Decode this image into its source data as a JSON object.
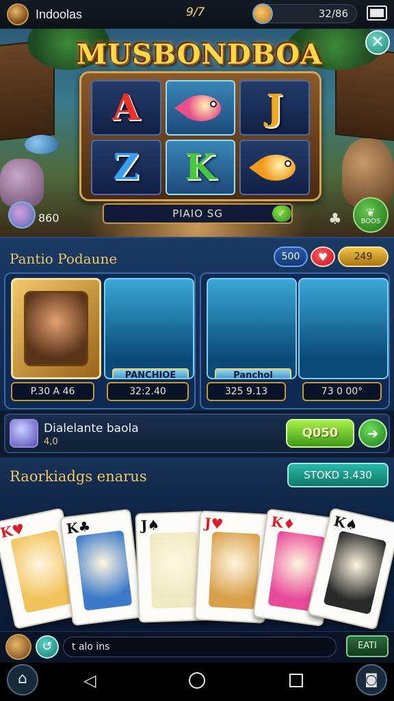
{
  "status_bar": {
    "app_name": "Indoolas",
    "clock": "9/7",
    "coin_balance": "32/86",
    "avatar_icon": "medallion-avatar-icon",
    "coin_icon": "piggy-coin-icon",
    "battery_icon": "battery-icon"
  },
  "hero": {
    "game_title": "MUSBONDBOA",
    "close_icon": "close-icon",
    "reels": [
      {
        "symbol": "A",
        "color": "#e8322a"
      },
      {
        "symbol": "fish",
        "color": "#e8508a"
      },
      {
        "symbol": "J",
        "color": "#f2a81e"
      },
      {
        "symbol": "Z",
        "color": "#3a9ef0"
      },
      {
        "symbol": "K",
        "color": "#46c83a"
      },
      {
        "symbol": "fish",
        "color": "#f29a1e"
      }
    ],
    "name_field": "PIAIO SG",
    "name_check_icon": "check-icon",
    "level_value": "860",
    "level_icon": "parrot-badge-icon",
    "tree_icon": "tree-icon",
    "boost_label": "BOOS",
    "boost_icon": "leaf-icon"
  },
  "panel": {
    "title": "Pantio Podaune",
    "pills": {
      "blue": "500",
      "red_icon": "heart-icon",
      "gold": "249"
    },
    "tiles": [
      {
        "kind": "portrait",
        "price": "P.30 A 46"
      },
      {
        "kind": "fish",
        "badge": "PANCHIOE",
        "price": "32:2.40"
      },
      {
        "kind": "fish",
        "badge": "Panchol",
        "price": "325 9.13"
      },
      {
        "kind": "fish",
        "price": "73 0 00°"
      }
    ]
  },
  "offer": {
    "title": "Dialelante  baola",
    "subtitle": "4,0",
    "buy_label": "Q050",
    "gem_icon": "crystal-gem-icon",
    "go_icon": "arrow-right-icon"
  },
  "section_two": {
    "title": "Raorkiadgs enarus",
    "teal_label": "STOKD  3.430",
    "cards": [
      {
        "rank": "K",
        "suit": "♥",
        "color": "red"
      },
      {
        "rank": "K",
        "suit": "♣",
        "color": "black"
      },
      {
        "rank": "J",
        "suit": "♠",
        "color": "black"
      },
      {
        "rank": "J",
        "suit": "♥",
        "color": "red"
      },
      {
        "rank": "K",
        "suit": "♦",
        "color": "red"
      },
      {
        "rank": "K",
        "suit": "♠",
        "color": "black"
      }
    ]
  },
  "chat": {
    "placeholder": "t alo ins",
    "send_label": "EATI",
    "refresh_icon": "refresh-icon"
  },
  "nav": {
    "home_icon": "home-icon",
    "back_icon": "back-triangle-icon",
    "circle_icon": "home-circle-icon",
    "square_icon": "recents-square-icon",
    "camera_icon": "camera-icon"
  }
}
